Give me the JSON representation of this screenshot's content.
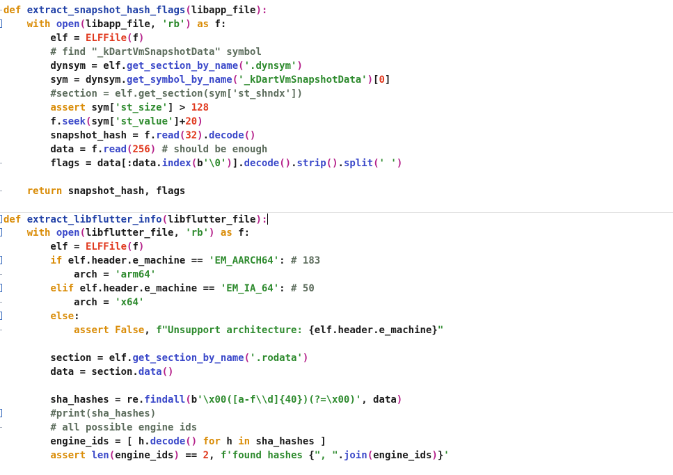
{
  "editor": {
    "language": "python",
    "lines": [
      {
        "marker": "dash",
        "sep": false,
        "tokens": [
          {
            "t": "def",
            "c": "k"
          },
          {
            "t": " "
          },
          {
            "t": "extract_snapshot_hash_flags",
            "c": "fn"
          },
          {
            "t": "(",
            "c": "p"
          },
          {
            "t": "libapp_file"
          },
          {
            "t": "):",
            "c": "p"
          }
        ]
      },
      {
        "marker": "bracket",
        "sep": false,
        "tokens": [
          {
            "t": "    "
          },
          {
            "t": "with",
            "c": "k"
          },
          {
            "t": " "
          },
          {
            "t": "open",
            "c": "b"
          },
          {
            "t": "(",
            "c": "p"
          },
          {
            "t": "libapp_file, "
          },
          {
            "t": "'rb'",
            "c": "s"
          },
          {
            "t": ") ",
            "c": "p"
          },
          {
            "t": "as",
            "c": "k"
          },
          {
            "t": " f:"
          }
        ]
      },
      {
        "marker": "",
        "sep": false,
        "tokens": [
          {
            "t": "        elf = "
          },
          {
            "t": "ELFFile",
            "c": "cls"
          },
          {
            "t": "(",
            "c": "p"
          },
          {
            "t": "f"
          },
          {
            "t": ")",
            "c": "p"
          }
        ]
      },
      {
        "marker": "",
        "sep": false,
        "tokens": [
          {
            "t": "        "
          },
          {
            "t": "# find \"_kDartVmSnapshotData\" symbol",
            "c": "c"
          }
        ]
      },
      {
        "marker": "",
        "sep": false,
        "tokens": [
          {
            "t": "        dynsym = elf."
          },
          {
            "t": "get_section_by_name",
            "c": "b"
          },
          {
            "t": "(",
            "c": "p"
          },
          {
            "t": "'.dynsym'",
            "c": "s"
          },
          {
            "t": ")",
            "c": "p"
          }
        ]
      },
      {
        "marker": "",
        "sep": false,
        "tokens": [
          {
            "t": "        sym = dynsym."
          },
          {
            "t": "get_symbol_by_name",
            "c": "b"
          },
          {
            "t": "(",
            "c": "p"
          },
          {
            "t": "'_kDartVmSnapshotData'",
            "c": "s"
          },
          {
            "t": ")",
            "c": "p"
          },
          {
            "t": "["
          },
          {
            "t": "0",
            "c": "n"
          },
          {
            "t": "]"
          }
        ]
      },
      {
        "marker": "",
        "sep": false,
        "tokens": [
          {
            "t": "        "
          },
          {
            "t": "#section = elf.get_section(sym['st_shndx'])",
            "c": "c"
          }
        ]
      },
      {
        "marker": "",
        "sep": false,
        "tokens": [
          {
            "t": "        "
          },
          {
            "t": "assert",
            "c": "k"
          },
          {
            "t": " sym["
          },
          {
            "t": "'st_size'",
            "c": "s"
          },
          {
            "t": "] > "
          },
          {
            "t": "128",
            "c": "n"
          }
        ]
      },
      {
        "marker": "",
        "sep": false,
        "tokens": [
          {
            "t": "        f."
          },
          {
            "t": "seek",
            "c": "b"
          },
          {
            "t": "(",
            "c": "p"
          },
          {
            "t": "sym["
          },
          {
            "t": "'st_value'",
            "c": "s"
          },
          {
            "t": "]+"
          },
          {
            "t": "20",
            "c": "n"
          },
          {
            "t": ")",
            "c": "p"
          }
        ]
      },
      {
        "marker": "",
        "sep": false,
        "tokens": [
          {
            "t": "        snapshot_hash = f."
          },
          {
            "t": "read",
            "c": "b"
          },
          {
            "t": "(",
            "c": "p"
          },
          {
            "t": "32",
            "c": "n"
          },
          {
            "t": ")",
            "c": "p"
          },
          {
            "t": "."
          },
          {
            "t": "decode",
            "c": "b"
          },
          {
            "t": "()",
            "c": "p"
          }
        ]
      },
      {
        "marker": "",
        "sep": false,
        "tokens": [
          {
            "t": "        data = f."
          },
          {
            "t": "read",
            "c": "b"
          },
          {
            "t": "(",
            "c": "p"
          },
          {
            "t": "256",
            "c": "n"
          },
          {
            "t": ")",
            "c": "p"
          },
          {
            "t": " "
          },
          {
            "t": "# should be enough",
            "c": "c"
          }
        ]
      },
      {
        "marker": "dash",
        "sep": false,
        "tokens": [
          {
            "t": "        flags = data[:data."
          },
          {
            "t": "index",
            "c": "b"
          },
          {
            "t": "(",
            "c": "p"
          },
          {
            "t": "b"
          },
          {
            "t": "'\\0'",
            "c": "s"
          },
          {
            "t": ")",
            "c": "p"
          },
          {
            "t": "]."
          },
          {
            "t": "decode",
            "c": "b"
          },
          {
            "t": "()",
            "c": "p"
          },
          {
            "t": "."
          },
          {
            "t": "strip",
            "c": "b"
          },
          {
            "t": "()",
            "c": "p"
          },
          {
            "t": "."
          },
          {
            "t": "split",
            "c": "b"
          },
          {
            "t": "(",
            "c": "p"
          },
          {
            "t": "' '",
            "c": "s"
          },
          {
            "t": ")",
            "c": "p"
          }
        ]
      },
      {
        "marker": "",
        "sep": false,
        "tokens": [
          {
            "t": ""
          }
        ]
      },
      {
        "marker": "dash",
        "sep": false,
        "tokens": [
          {
            "t": "    "
          },
          {
            "t": "return",
            "c": "k"
          },
          {
            "t": " snapshot_hash, flags"
          }
        ]
      },
      {
        "marker": "",
        "sep": false,
        "tokens": [
          {
            "t": ""
          }
        ]
      },
      {
        "marker": "bracket",
        "sep": true,
        "tokens": [
          {
            "t": "def",
            "c": "k"
          },
          {
            "t": " "
          },
          {
            "t": "extract_libflutter_info",
            "c": "fn"
          },
          {
            "t": "(",
            "c": "p"
          },
          {
            "t": "libflutter_file"
          },
          {
            "t": "):",
            "c": "p"
          },
          {
            "t": "|caret|"
          }
        ]
      },
      {
        "marker": "bracket",
        "sep": false,
        "tokens": [
          {
            "t": "    "
          },
          {
            "t": "with",
            "c": "k"
          },
          {
            "t": " "
          },
          {
            "t": "open",
            "c": "b"
          },
          {
            "t": "(",
            "c": "p"
          },
          {
            "t": "libflutter_file, "
          },
          {
            "t": "'rb'",
            "c": "s"
          },
          {
            "t": ") ",
            "c": "p"
          },
          {
            "t": "as",
            "c": "k"
          },
          {
            "t": " f:"
          }
        ]
      },
      {
        "marker": "",
        "sep": false,
        "tokens": [
          {
            "t": "        elf = "
          },
          {
            "t": "ELFFile",
            "c": "cls"
          },
          {
            "t": "(",
            "c": "p"
          },
          {
            "t": "f"
          },
          {
            "t": ")",
            "c": "p"
          }
        ]
      },
      {
        "marker": "bracket",
        "sep": false,
        "tokens": [
          {
            "t": "        "
          },
          {
            "t": "if",
            "c": "k"
          },
          {
            "t": " elf.header.e_machine == "
          },
          {
            "t": "'EM_AARCH64'",
            "c": "s"
          },
          {
            "t": ": "
          },
          {
            "t": "# 183",
            "c": "c"
          }
        ]
      },
      {
        "marker": "dash",
        "sep": false,
        "tokens": [
          {
            "t": "            arch = "
          },
          {
            "t": "'arm64'",
            "c": "s"
          }
        ]
      },
      {
        "marker": "bracket",
        "sep": false,
        "tokens": [
          {
            "t": "        "
          },
          {
            "t": "elif",
            "c": "k"
          },
          {
            "t": " elf.header.e_machine == "
          },
          {
            "t": "'EM_IA_64'",
            "c": "s"
          },
          {
            "t": ": "
          },
          {
            "t": "# 50",
            "c": "c"
          }
        ]
      },
      {
        "marker": "dash",
        "sep": false,
        "tokens": [
          {
            "t": "            arch = "
          },
          {
            "t": "'x64'",
            "c": "s"
          }
        ]
      },
      {
        "marker": "bracket",
        "sep": false,
        "tokens": [
          {
            "t": "        "
          },
          {
            "t": "else",
            "c": "k"
          },
          {
            "t": ":"
          }
        ]
      },
      {
        "marker": "dash",
        "sep": false,
        "tokens": [
          {
            "t": "            "
          },
          {
            "t": "assert",
            "c": "k"
          },
          {
            "t": " "
          },
          {
            "t": "False",
            "c": "k"
          },
          {
            "t": ", "
          },
          {
            "t": "f\"Unsupport architecture: ",
            "c": "s"
          },
          {
            "t": "{"
          },
          {
            "t": "elf.header.e_machine"
          },
          {
            "t": "}"
          },
          {
            "t": "\"",
            "c": "s"
          }
        ]
      },
      {
        "marker": "",
        "sep": false,
        "tokens": [
          {
            "t": ""
          }
        ]
      },
      {
        "marker": "",
        "sep": false,
        "tokens": [
          {
            "t": "        section = elf."
          },
          {
            "t": "get_section_by_name",
            "c": "b"
          },
          {
            "t": "(",
            "c": "p"
          },
          {
            "t": "'.rodata'",
            "c": "s"
          },
          {
            "t": ")",
            "c": "p"
          }
        ]
      },
      {
        "marker": "",
        "sep": false,
        "tokens": [
          {
            "t": "        data = section."
          },
          {
            "t": "data",
            "c": "b"
          },
          {
            "t": "()",
            "c": "p"
          }
        ]
      },
      {
        "marker": "",
        "sep": false,
        "tokens": [
          {
            "t": ""
          }
        ]
      },
      {
        "marker": "",
        "sep": false,
        "tokens": [
          {
            "t": "        sha_hashes = re."
          },
          {
            "t": "findall",
            "c": "b"
          },
          {
            "t": "(",
            "c": "p"
          },
          {
            "t": "b"
          },
          {
            "t": "'\\x00([a-f\\\\d]{40})(?=\\x00)'",
            "c": "s"
          },
          {
            "t": ", data"
          },
          {
            "t": ")",
            "c": "p"
          }
        ]
      },
      {
        "marker": "bracket",
        "sep": false,
        "tokens": [
          {
            "t": "        "
          },
          {
            "t": "#print(sha_hashes)",
            "c": "c"
          }
        ]
      },
      {
        "marker": "dash",
        "sep": false,
        "tokens": [
          {
            "t": "        "
          },
          {
            "t": "# all possible engine ids",
            "c": "c"
          }
        ]
      },
      {
        "marker": "",
        "sep": false,
        "tokens": [
          {
            "t": "        engine_ids = [ h."
          },
          {
            "t": "decode",
            "c": "b"
          },
          {
            "t": "()",
            "c": "p"
          },
          {
            "t": " "
          },
          {
            "t": "for",
            "c": "k"
          },
          {
            "t": " h "
          },
          {
            "t": "in",
            "c": "k"
          },
          {
            "t": " sha_hashes ]"
          }
        ]
      },
      {
        "marker": "",
        "sep": false,
        "tokens": [
          {
            "t": "        "
          },
          {
            "t": "assert",
            "c": "k"
          },
          {
            "t": " "
          },
          {
            "t": "len",
            "c": "b"
          },
          {
            "t": "(",
            "c": "p"
          },
          {
            "t": "engine_ids"
          },
          {
            "t": ")",
            "c": "p"
          },
          {
            "t": " == "
          },
          {
            "t": "2",
            "c": "n"
          },
          {
            "t": ", "
          },
          {
            "t": "f'found hashes ",
            "c": "s"
          },
          {
            "t": "{"
          },
          {
            "t": "\", \"",
            "c": "s"
          },
          {
            "t": "."
          },
          {
            "t": "join",
            "c": "b"
          },
          {
            "t": "(",
            "c": "p"
          },
          {
            "t": "engine_ids"
          },
          {
            "t": ")",
            "c": "p"
          },
          {
            "t": "}"
          },
          {
            "t": "'",
            "c": "s"
          }
        ]
      }
    ]
  }
}
